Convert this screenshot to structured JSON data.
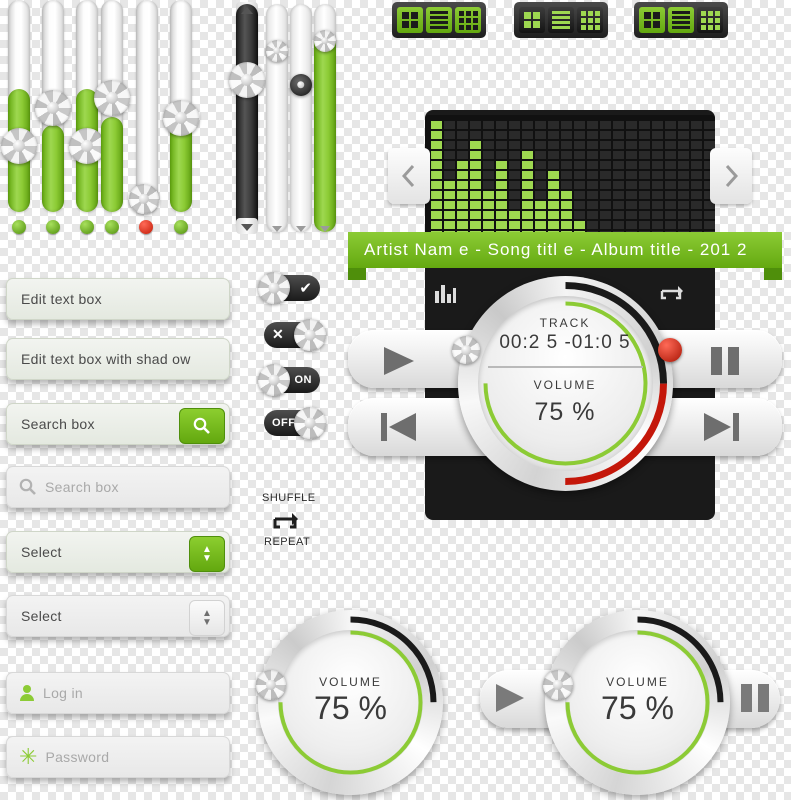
{
  "meta": {
    "title": "Music Player UI Kit",
    "accent_green": "#8ccb35",
    "accent_green_dark": "#63a80f",
    "red": "#c4170a",
    "dark": "#1a1a1a"
  },
  "sliders": {
    "vertical_green": [
      {
        "name": "slider-1",
        "fill_percent": 58
      },
      {
        "name": "slider-2",
        "fill_percent": 41
      },
      {
        "name": "slider-3",
        "fill_percent": 58
      },
      {
        "name": "slider-4",
        "fill_percent": 45
      },
      {
        "name": "slider-5",
        "fill_percent": 3
      },
      {
        "name": "slider-6",
        "fill_percent": 52
      }
    ],
    "vertical_dark": {
      "name": "slider-dark",
      "fill_percent": 0
    },
    "vertical_white_1": {
      "name": "slider-white-1",
      "fill_percent": 0
    },
    "vertical_white_2": {
      "name": "slider-white-2",
      "fill_percent": 0
    },
    "vertical_green_tall": {
      "name": "slider-green-tall",
      "fill_percent": 88
    }
  },
  "form": {
    "edit_text_box": {
      "label": "Edit  text box",
      "value": "Edit  text box"
    },
    "edit_text_box_shadow": {
      "label": "Edit  text box with shad ow",
      "value": "Edit  text box with shad ow"
    },
    "search_box_green": {
      "value": "Search box",
      "icon": "search-icon"
    },
    "search_box_plain": {
      "placeholder": "Search box",
      "icon": "search-icon"
    },
    "select_green": {
      "value": "Select",
      "icon": "chevron-updown-icon"
    },
    "select_plain": {
      "value": "Select",
      "icon": "chevron-updown-icon"
    },
    "login": {
      "placeholder": "Log in",
      "icon": "user-icon"
    },
    "password": {
      "placeholder": "Password",
      "icon": "asterisk-icon"
    }
  },
  "toggles": [
    {
      "name": "toggle-check",
      "state": "on",
      "label": "",
      "icon": "check-icon"
    },
    {
      "name": "toggle-cross",
      "state": "off",
      "label": "",
      "icon": "cross-icon"
    },
    {
      "name": "toggle-on",
      "state": "on",
      "label": "ON"
    },
    {
      "name": "toggle-off",
      "state": "off",
      "label": "OFF"
    }
  ],
  "player_extra": {
    "shuffle_label": "SHUFFLE",
    "repeat_label": "REPEAT",
    "repeat_icon": "repeat-icon"
  },
  "view_toggle_groups": [
    {
      "name": "view-group-1",
      "buttons": [
        {
          "name": "grid-view-button",
          "icon": "grid-icon",
          "active": true
        },
        {
          "name": "list-view-button",
          "icon": "list-icon",
          "active": true
        },
        {
          "name": "thumbnail-view-button",
          "icon": "dots-grid-icon",
          "active": true
        }
      ]
    },
    {
      "name": "view-group-2",
      "buttons": [
        {
          "name": "grid-view-button",
          "icon": "grid-icon",
          "active": true
        },
        {
          "name": "list-view-button",
          "icon": "list-icon",
          "active": true
        },
        {
          "name": "thumbnail-view-button",
          "icon": "dots-grid-icon",
          "active": true
        }
      ]
    },
    {
      "name": "view-group-3",
      "buttons": [
        {
          "name": "grid-view-button",
          "icon": "grid-icon",
          "active": true
        },
        {
          "name": "list-view-button",
          "icon": "list-icon",
          "active": true
        },
        {
          "name": "thumbnail-view-button",
          "icon": "dots-grid-icon",
          "active": false
        }
      ]
    }
  ],
  "player": {
    "prev_page_icon": "chevron-left-icon",
    "next_page_icon": "chevron-right-icon",
    "banner_text": "Artist Nam e - Song titl e - Album title - 201 2",
    "equalizer_icon": "equalizer-icon",
    "repeat_icon": "repeat-icon",
    "play_icon": "play-icon",
    "pause_icon": "pause-icon",
    "prev_icon": "previous-track-icon",
    "next_icon": "next-track-icon",
    "track_label": "TRACK",
    "track_time": "00:2 5 -01:0 5",
    "volume_label": "VOLUME",
    "volume_value": "75 %",
    "volume_percent": 75,
    "progress_percent": 38
  },
  "volume_widgets": [
    {
      "name": "volume-dial-standalone",
      "label": "VOLUME",
      "value": "75 %",
      "percent": 75
    },
    {
      "name": "volume-dial-with-controls",
      "label": "VOLUME",
      "value": "75 %",
      "percent": 75,
      "play_icon": "play-icon",
      "pause_icon": "pause-icon"
    }
  ]
}
